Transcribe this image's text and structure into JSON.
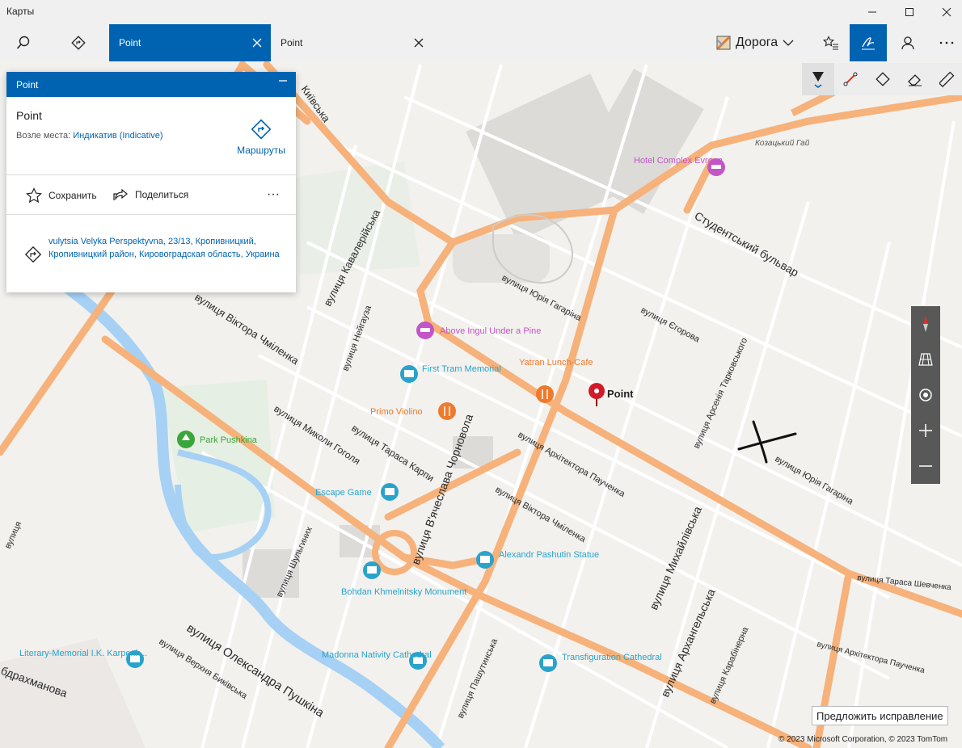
{
  "app": {
    "title": "Карты"
  },
  "window": {
    "minimize": "—",
    "maximize": "☐",
    "close": "✕"
  },
  "toolbar": {
    "tabs": [
      {
        "label": "Point",
        "active": true
      },
      {
        "label": "Point",
        "active": false
      }
    ],
    "layer": "Дорога",
    "accent": "#0063b1"
  },
  "panel": {
    "header": "Point",
    "name": "Point",
    "near_label": "Возле места:",
    "near_value": "Индикатив (Indicative)",
    "routes": "Маршруты",
    "save": "Сохранить",
    "share": "Поделиться",
    "more": "···",
    "address": "vulytsia Velyka Perspektyvna, 23/13, Кропивницкий, Кропивницкий район, Кировоградская область, Украина"
  },
  "map": {
    "streets": [
      "вулиця Кавалерійська",
      "вулиця Віктора Чміленка",
      "вулиця Нейгауза",
      "вулиця Миколи Гоголя",
      "вулиця Тараса Карпи",
      "вулиця В'ячеслава Чорновола",
      "вулиця Архітектора Паученка",
      "вулиця Віктора Чміленка",
      "вулиця Юрія Гагаріна",
      "вулиця Єгорова",
      "Студентський бульвар",
      "вулиця Арсенія Тарковського",
      "вулиця Юрія Гагаріна",
      "вулиця Михайлівська",
      "вулиця Архангельська",
      "вулиця Карабінерна",
      "вулиця Тараса Шевченка",
      "вулиця Архітектора Паученка",
      "вулиця Шульгиних",
      "вулиця Олександра Пушкіна",
      "вулиця Верхня Биківська",
      "вулиця Пашутинська",
      "Козацький Гай",
      "Київська",
      "бдрахманова",
      "вулиця"
    ],
    "pois": [
      {
        "name": "Hotel Complex Evropa",
        "type": "hotel",
        "color": "#c355c7"
      },
      {
        "name": "Above Ingul Under a Pine",
        "type": "hotel",
        "color": "#c355c7"
      },
      {
        "name": "First Tram Memorial",
        "type": "museum",
        "color": "#29a3cc"
      },
      {
        "name": "Yatran Lunch-Cafe",
        "type": "restaurant",
        "color": "#ee7a2c"
      },
      {
        "name": "Primo Violino",
        "type": "restaurant",
        "color": "#ee7a2c"
      },
      {
        "name": "Park Pushkina",
        "type": "park",
        "color": "#3aa53a"
      },
      {
        "name": "Escape Game",
        "type": "museum",
        "color": "#29a3cc"
      },
      {
        "name": "Alexandr Pashutin Statue",
        "type": "museum",
        "color": "#29a3cc"
      },
      {
        "name": "Bohdan Khmelnitsky Monument",
        "type": "museum",
        "color": "#29a3cc"
      },
      {
        "name": "Madonna Nativity Cathedral",
        "type": "museum",
        "color": "#29a3cc"
      },
      {
        "name": "Transfiguration Cathedral",
        "type": "museum",
        "color": "#29a3cc"
      },
      {
        "name": "Literary-Memorial I.K. Karpenk...",
        "type": "museum",
        "color": "#29a3cc"
      }
    ],
    "pin_label": "Point",
    "pin_color": "#d11a2a",
    "suggest": "Предложить исправление",
    "copyright": "© 2023 Microsoft Corporation, © 2023 TomTom"
  }
}
